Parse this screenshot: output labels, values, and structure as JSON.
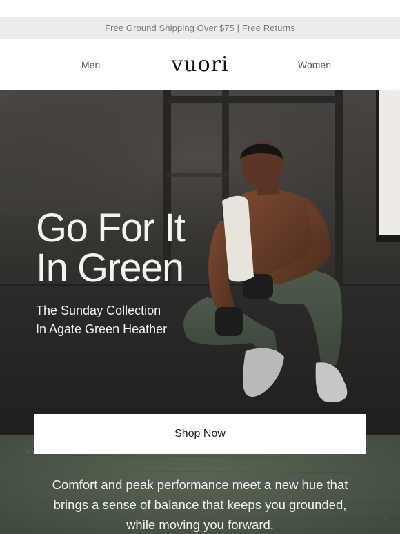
{
  "promo": {
    "text": "Free Ground Shipping Over $75 | Free Returns"
  },
  "nav": {
    "men_label": "Men",
    "logo_text": "vuori",
    "women_label": "Women"
  },
  "hero": {
    "headline": "Go For It In Green",
    "subheadline_line1": "The Sunday Collection",
    "subheadline_line2": "In Agate Green Heather"
  },
  "cta": {
    "label": "Shop Now"
  },
  "body": {
    "copy": "Comfort and peak performance meet a new hue that brings a sense of balance that keeps you grounded, while moving you forward."
  },
  "colors": {
    "promo_bg": "#ececec",
    "hero_bg": "#3b3936",
    "lower_bg": "#4e5849",
    "button_bg": "#ffffff"
  }
}
